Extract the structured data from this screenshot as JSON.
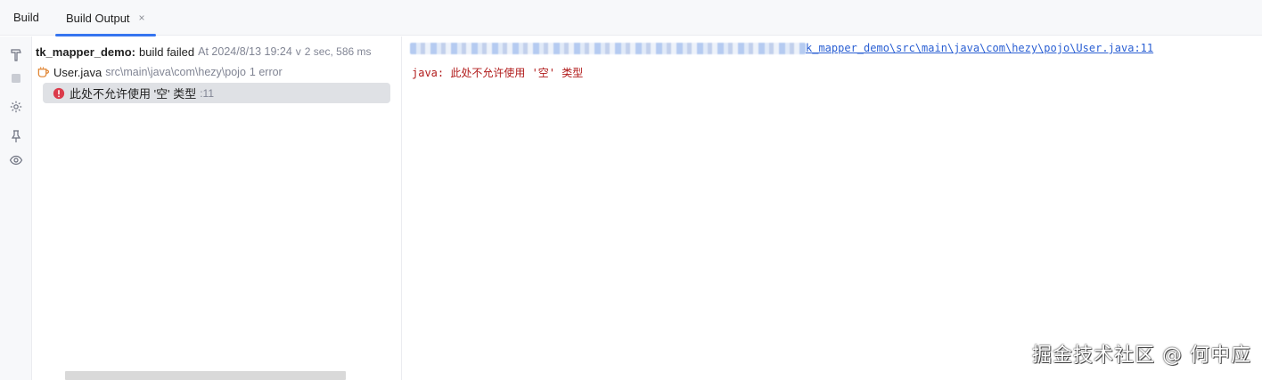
{
  "tabbar": {
    "title": "Build",
    "tab_label": "Build Output",
    "close_glyph": "×"
  },
  "toolbar": {
    "icons": [
      "hammer-icon",
      "stop-icon",
      "gear-icon",
      "pin-icon",
      "eye-icon"
    ]
  },
  "tree": {
    "root": {
      "project": "tk_mapper_demo:",
      "status": "build failed",
      "time": "At 2024/8/13 19:24",
      "duration": "2 sec, 586 ms",
      "chevron": "v"
    },
    "file": {
      "name": "User.java",
      "path": "src\\main\\java\\com\\hezy\\pojo",
      "count": "1 error"
    },
    "error": {
      "message": "此处不允许使用 '空' 类型",
      "line": ":11"
    }
  },
  "console": {
    "path_link": "k_mapper_demo\\src\\main\\java\\com\\hezy\\pojo\\User.java:11",
    "error_text": "java: 此处不允许使用 '空' 类型"
  },
  "watermark": "掘金技术社区 @ 何中应",
  "colors": {
    "accent": "#3574f0",
    "error": "#db3b4b",
    "link": "#2a5fd3",
    "console_error": "#b11b1b"
  }
}
